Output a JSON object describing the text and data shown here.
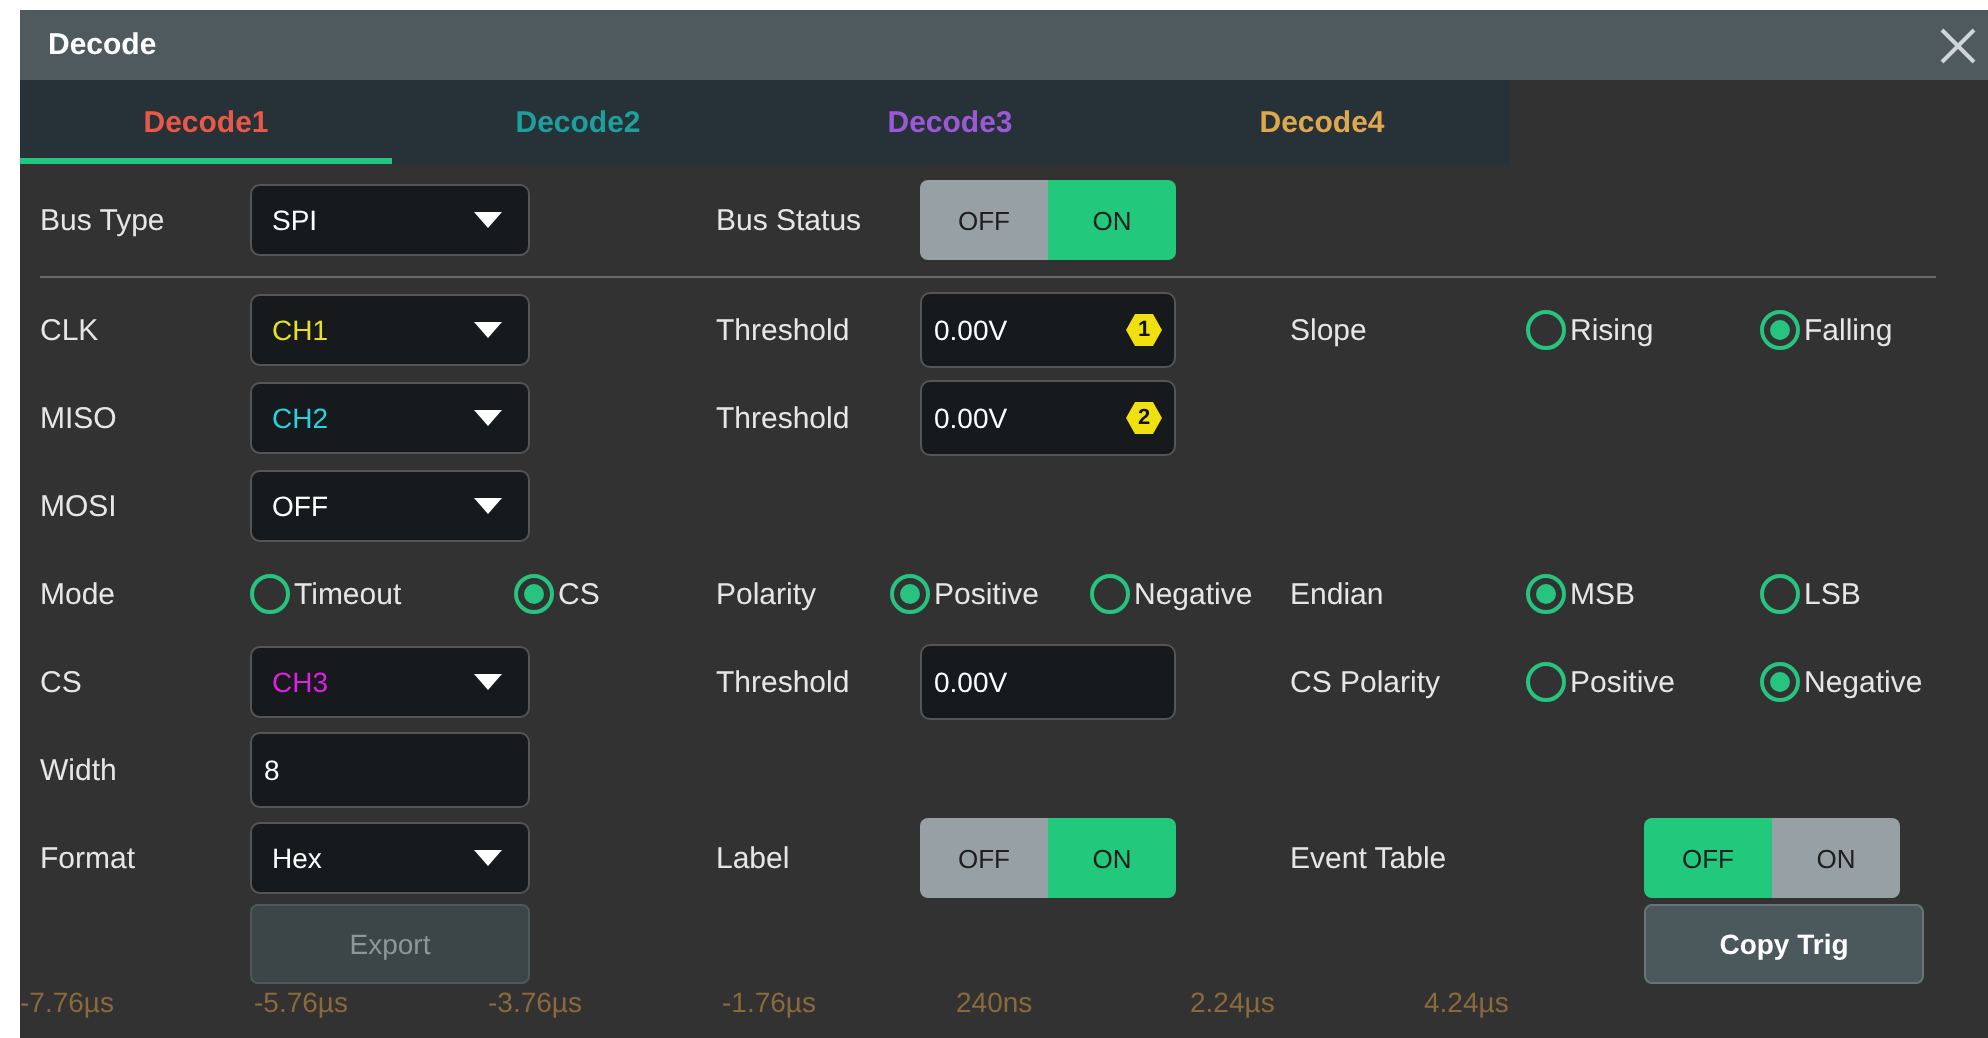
{
  "dialog": {
    "title": "Decode"
  },
  "tabs": [
    {
      "label": "Decode1",
      "color": "#e8594a",
      "selected": true
    },
    {
      "label": "Decode2",
      "color": "#1f9e9e",
      "selected": false
    },
    {
      "label": "Decode3",
      "color": "#9b59d6",
      "selected": false
    },
    {
      "label": "Decode4",
      "color": "#e0a84e",
      "selected": false
    }
  ],
  "rows": [
    {
      "items": [
        {
          "kind": "label",
          "text": "Bus Type"
        },
        {
          "kind": "dropdown",
          "value": "SPI",
          "color": "#ffffff"
        },
        {
          "kind": "label",
          "text": "Bus Status"
        },
        {
          "kind": "toggle",
          "options": [
            {
              "label": "OFF",
              "selected": false
            },
            {
              "label": "ON",
              "selected": true
            }
          ]
        }
      ]
    },
    {
      "items": [
        {
          "kind": "label",
          "text": "CLK"
        },
        {
          "kind": "dropdown",
          "value": "CH1",
          "color": "#e6e02a"
        },
        {
          "kind": "label",
          "text": "Threshold"
        },
        {
          "kind": "input",
          "value": "0.00V",
          "badge": "1"
        },
        {
          "kind": "label",
          "text": "Slope"
        },
        {
          "kind": "radio",
          "text": "Rising",
          "selected": false
        },
        {
          "kind": "radio",
          "text": "Falling",
          "selected": true
        }
      ]
    },
    {
      "items": [
        {
          "kind": "label",
          "text": "MISO"
        },
        {
          "kind": "dropdown",
          "value": "CH2",
          "color": "#27d3e0"
        },
        {
          "kind": "label",
          "text": "Threshold"
        },
        {
          "kind": "input",
          "value": "0.00V",
          "badge": "2"
        }
      ]
    },
    {
      "items": [
        {
          "kind": "label",
          "text": "MOSI"
        },
        {
          "kind": "dropdown",
          "value": "OFF",
          "color": "#ffffff"
        }
      ]
    },
    {
      "items": [
        {
          "kind": "label",
          "text": "Mode"
        },
        {
          "kind": "radio",
          "text": "Timeout",
          "selected": false
        },
        {
          "kind": "radio",
          "text": "CS",
          "selected": true
        },
        {
          "kind": "label",
          "text": "Polarity"
        },
        {
          "kind": "radio",
          "text": "Positive",
          "selected": true
        },
        {
          "kind": "radio",
          "text": "Negative",
          "selected": false
        },
        {
          "kind": "label",
          "text": "Endian"
        },
        {
          "kind": "radio",
          "text": "MSB",
          "selected": true
        },
        {
          "kind": "radio",
          "text": "LSB",
          "selected": false
        }
      ]
    },
    {
      "items": [
        {
          "kind": "label",
          "text": "CS"
        },
        {
          "kind": "dropdown",
          "value": "CH3",
          "color": "#e020e0"
        },
        {
          "kind": "label",
          "text": "Threshold"
        },
        {
          "kind": "input",
          "value": "0.00V"
        },
        {
          "kind": "label",
          "text": "CS Polarity"
        },
        {
          "kind": "radio",
          "text": "Positive",
          "selected": false
        },
        {
          "kind": "radio",
          "text": "Negative",
          "selected": true
        }
      ]
    },
    {
      "items": [
        {
          "kind": "label",
          "text": "Width"
        },
        {
          "kind": "input",
          "value": "8"
        }
      ]
    },
    {
      "items": [
        {
          "kind": "label",
          "text": "Format"
        },
        {
          "kind": "dropdown",
          "value": "Hex",
          "color": "#ffffff"
        },
        {
          "kind": "label",
          "text": "Label"
        },
        {
          "kind": "toggle",
          "options": [
            {
              "label": "OFF",
              "selected": false
            },
            {
              "label": "ON",
              "selected": true
            }
          ]
        },
        {
          "kind": "label",
          "text": "Event Table"
        },
        {
          "kind": "toggle",
          "options": [
            {
              "label": "OFF",
              "selected": true
            },
            {
              "label": "ON",
              "selected": false
            }
          ]
        }
      ]
    }
  ],
  "buttons": [
    {
      "label": "Export",
      "disabled": true
    },
    {
      "label": "Copy Trig",
      "disabled": false
    }
  ],
  "time_axis": [
    "-7.76µs",
    "-5.76µs",
    "-3.76µs",
    "-1.76µs",
    "240ns",
    "2.24µs",
    "4.24µs"
  ]
}
